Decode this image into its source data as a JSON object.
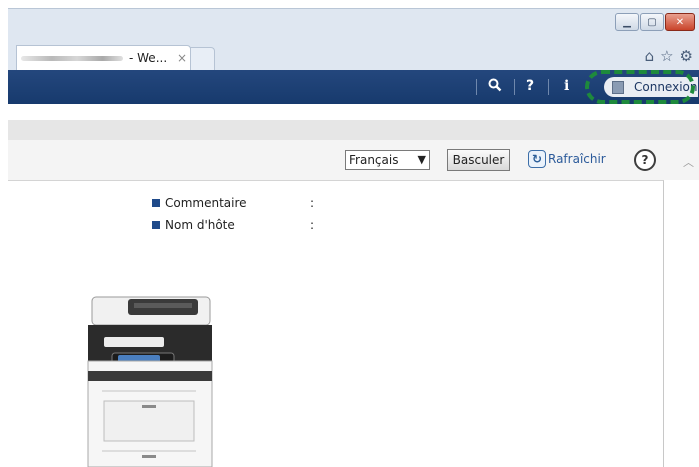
{
  "browser": {
    "tab_title": "- We...",
    "tab_close": "×",
    "window_buttons": [
      "minimize",
      "maximize",
      "close"
    ],
    "toolbar_icons": [
      "home-icon",
      "star-icon",
      "gear-icon"
    ]
  },
  "header": {
    "search_icon": "search-icon",
    "help_label": "?",
    "info_label": "i",
    "login_label": "Connexion"
  },
  "controls": {
    "language_value": "Français",
    "switch_label": "Basculer",
    "refresh_label": "Rafraîchir",
    "help_label": "?"
  },
  "device_info": {
    "rows": [
      {
        "label": "Commentaire",
        "separator": ":"
      },
      {
        "label": "Nom d'hôte",
        "separator": ":"
      }
    ]
  },
  "colors": {
    "header_bar": "#1b3f75",
    "highlight": "#1e8a3c",
    "bullet": "#1f4a8a",
    "link": "#2b5a9a"
  }
}
